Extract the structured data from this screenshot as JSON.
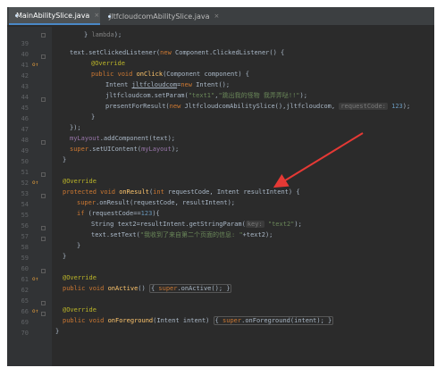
{
  "tabs": [
    {
      "label": "MainAbilitySlice.java",
      "close": "×"
    },
    {
      "label": "JltfcloudcomAbilitySlice.java",
      "close": "×"
    }
  ],
  "colors": {
    "arrow": "#e53935",
    "background": "#2b2b2b",
    "accent": "#4a88c7"
  },
  "code": {
    "l0": {
      "num": "",
      "c0": "}",
      "c1": "lambda",
      "c2": ");"
    },
    "l39": {
      "num": "39",
      "c0": "text.setClickedListener(",
      "c1": "new",
      "c2": " Component.ClickedListener() {"
    },
    "l40": {
      "num": "40",
      "c0": "@Override"
    },
    "l41": {
      "num": "41",
      "c0": "public void ",
      "c1": "onClick",
      "c2": "(Component component) {"
    },
    "l42": {
      "num": "42",
      "c0": "Intent ",
      "c1": "jltfcloudcom",
      "c2": "=",
      "c3": "new",
      "c4": " Intent();"
    },
    "l43": {
      "num": "43",
      "c0": "jltfcloudcom.setParam(",
      "c1": "\"text1\"",
      "c2": ",",
      "c3": "\"跳出我的怪物 我弄弄哒!!\"",
      "c4": ");"
    },
    "l44": {
      "num": "44",
      "c0": "presentForResult(",
      "c1": "new",
      "c2": " JltfcloudcomAbilitySlice(),jltfcloudcom,",
      "c3": "requestCode:",
      "c4": "123",
      "c5": ");"
    },
    "l45": {
      "num": "45",
      "c0": "}"
    },
    "l46": {
      "num": "46",
      "c0": "});"
    },
    "l47": {
      "num": "47",
      "c0": "myLayout",
      "c1": ".addComponent(text);"
    },
    "l48": {
      "num": "48",
      "c0": "super",
      "c1": ".setUIContent(",
      "c2": "myLayout",
      "c3": ");"
    },
    "l49": {
      "num": "49",
      "c0": "}"
    },
    "l50": {
      "num": "50"
    },
    "l51": {
      "num": "51",
      "c0": "@Override"
    },
    "l52": {
      "num": "52",
      "c0": "protected void ",
      "c1": "onResult",
      "c2": "(",
      "c3": "int",
      "c4": " requestCode, Intent resultIntent) {"
    },
    "l53": {
      "num": "53",
      "c0": "super",
      "c1": ".onResult(requestCode, resultIntent);"
    },
    "l54": {
      "num": "54",
      "c0": "if",
      "c1": " (requestCode==",
      "c2": "123",
      "c3": "){"
    },
    "l55": {
      "num": "55",
      "c0": "String text2=resultIntent.getStringParam(",
      "c1": "key:",
      "c2": "\"text2\"",
      "c3": ");"
    },
    "l56": {
      "num": "56",
      "c0": "text.setText(",
      "c1": "\"我收到了来自第二个页面的信息: \"",
      "c2": "+text2);"
    },
    "l57": {
      "num": "57",
      "c0": "}"
    },
    "l58": {
      "num": "58",
      "c0": "}"
    },
    "l59": {
      "num": "59"
    },
    "l60": {
      "num": "60",
      "c0": "@Override"
    },
    "l61": {
      "num": "61",
      "c0": "public void ",
      "c1": "onActive",
      "c2": "() ",
      "c3": "{",
      "c4": "super",
      "c5": ".onActive();",
      "c6": "}"
    },
    "l62": {
      "num": "62"
    },
    "l65": {
      "num": "65",
      "c0": "@Override"
    },
    "l66": {
      "num": "66",
      "c0": "public void ",
      "c1": "onForeground",
      "c2": "(Intent intent) ",
      "c3": "{",
      "c4": "super",
      "c5": ".onForeground(intent);",
      "c6": "}"
    },
    "l69": {
      "num": "69",
      "c0": "}"
    },
    "l70": {
      "num": "70"
    }
  }
}
